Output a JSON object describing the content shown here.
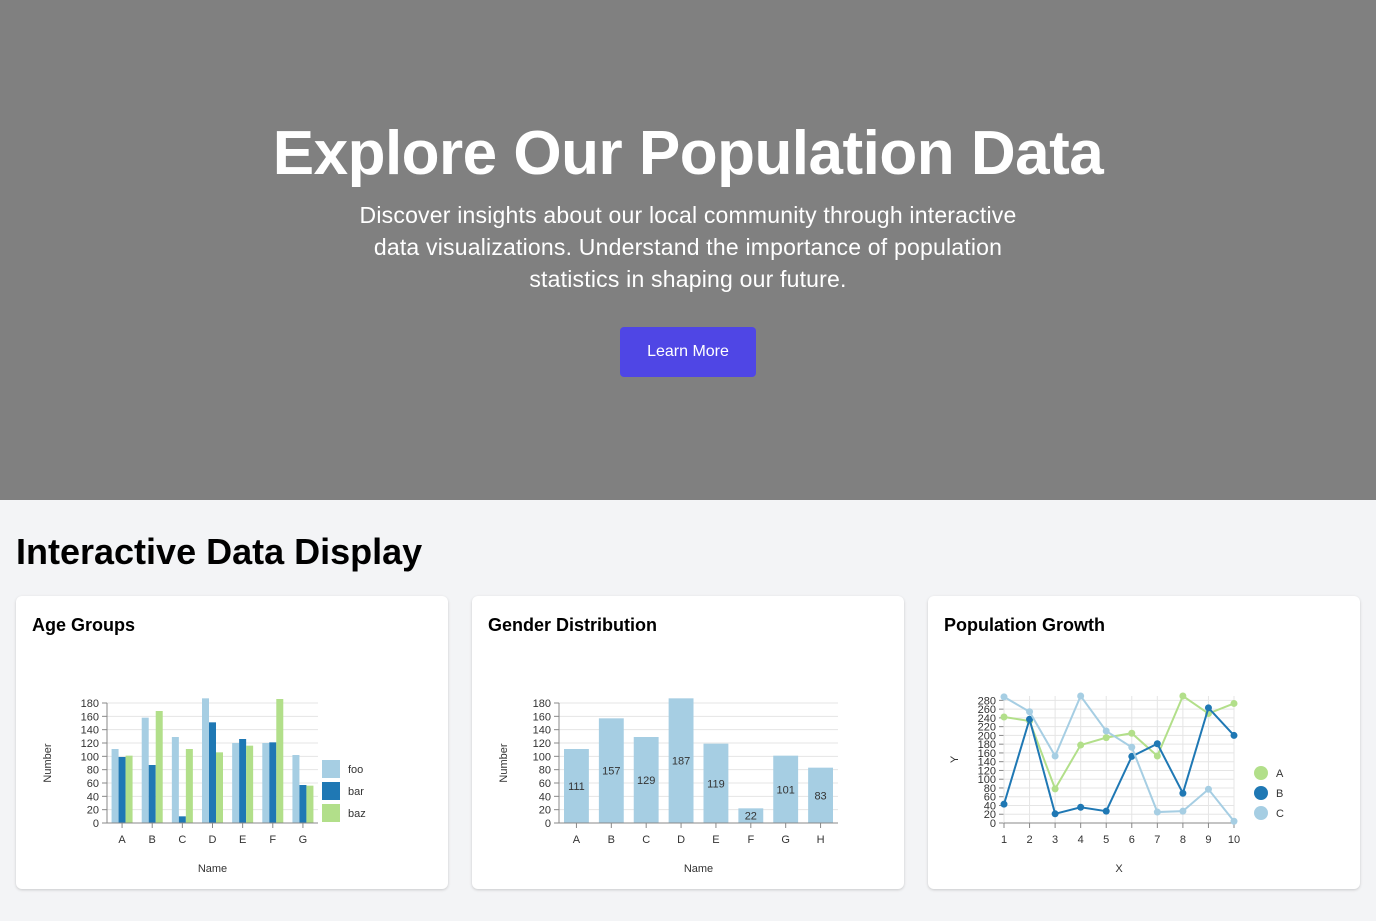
{
  "hero": {
    "title": "Explore Our Population Data",
    "subtitle": "Discover insights about our local community through interactive data visualizations. Understand the importance of population statistics in shaping our future.",
    "button_label": "Learn More",
    "background": "#808080",
    "button_color": "#4f46e5"
  },
  "section": {
    "title": "Interactive Data Display"
  },
  "cards": [
    {
      "title": "Age Groups"
    },
    {
      "title": "Gender Distribution"
    },
    {
      "title": "Population Growth"
    }
  ],
  "chart_data": [
    {
      "type": "bar",
      "xlabel": "Name",
      "ylabel": "Number",
      "categories": [
        "A",
        "B",
        "C",
        "D",
        "E",
        "F",
        "G"
      ],
      "yticks": [
        0,
        20,
        40,
        60,
        80,
        100,
        120,
        140,
        160,
        180
      ],
      "ylim": [
        0,
        180
      ],
      "legend_position": "right",
      "series": [
        {
          "name": "foo",
          "color": "#a6cee3",
          "values": [
            111,
            158,
            129,
            187,
            120,
            120,
            102
          ]
        },
        {
          "name": "bar",
          "color": "#1f78b4",
          "values": [
            99,
            87,
            10,
            151,
            126,
            121,
            57
          ]
        },
        {
          "name": "baz",
          "color": "#b2df8a",
          "values": [
            101,
            168,
            111,
            106,
            116,
            186,
            56
          ]
        }
      ]
    },
    {
      "type": "bar",
      "xlabel": "Name",
      "ylabel": "Number",
      "categories": [
        "A",
        "B",
        "C",
        "D",
        "E",
        "F",
        "G",
        "H"
      ],
      "yticks": [
        0,
        20,
        40,
        60,
        80,
        100,
        120,
        140,
        160,
        180
      ],
      "ylim": [
        0,
        180
      ],
      "color": "#a6cee3",
      "values": [
        111,
        157,
        129,
        187,
        119,
        22,
        101,
        83
      ],
      "data_labels": true
    },
    {
      "type": "line",
      "xlabel": "X",
      "ylabel": "Y",
      "x": [
        1,
        2,
        3,
        4,
        5,
        6,
        7,
        8,
        9,
        10
      ],
      "yticks": [
        0,
        20,
        40,
        60,
        80,
        100,
        120,
        140,
        160,
        180,
        200,
        220,
        240,
        260,
        280
      ],
      "ylim": [
        0,
        290
      ],
      "legend_position": "right",
      "series": [
        {
          "name": "A",
          "color": "#b2df8a",
          "values": [
            242,
            233,
            78,
            178,
            195,
            205,
            153,
            290,
            250,
            273
          ]
        },
        {
          "name": "B",
          "color": "#1f78b4",
          "values": [
            43,
            237,
            21,
            36,
            27,
            152,
            181,
            68,
            263,
            200
          ]
        },
        {
          "name": "C",
          "color": "#a6cee3",
          "values": [
            288,
            254,
            153,
            299,
            210,
            173,
            25,
            27,
            77,
            4
          ]
        }
      ]
    }
  ]
}
